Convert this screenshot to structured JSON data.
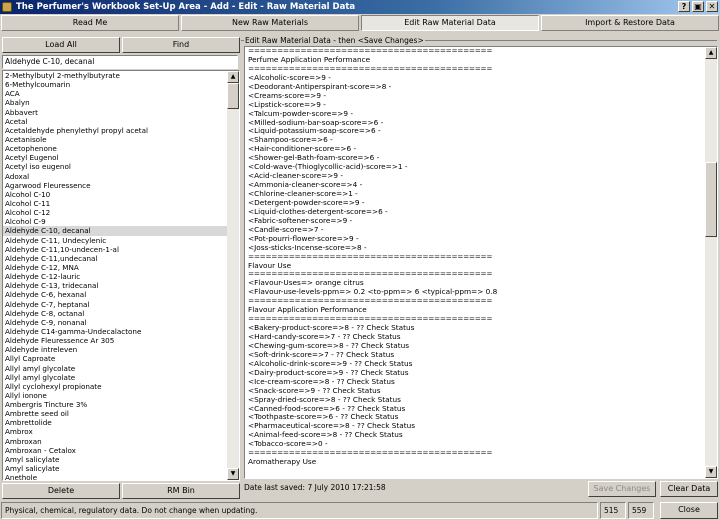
{
  "window": {
    "title": "The Perfumer's Workbook Set-Up Area  -  Add - Edit  -  Raw Material Data",
    "help_btn": "?",
    "max_btn": "▣",
    "close_btn": "✕"
  },
  "tabs": [
    "Read Me",
    "New Raw Materials",
    "Edit Raw Material Data",
    "Import & Restore Data"
  ],
  "left": {
    "load_all": "Load All",
    "find": "Find",
    "search_value": "Aldehyde C-10, decanal",
    "items": [
      "2-Methylbutyl 2-methylbutyrate",
      "6-Methylcoumarin",
      "ACA",
      "Abalyn",
      "Abbavert",
      "Acetal",
      "Acetaldehyde phenylethyl propyl acetal",
      "Acetanisole",
      "Acetophenone",
      "Acetyl Eugenol",
      "Acetyl iso eugenol",
      "Adoxal",
      "Agarwood Fleuressence",
      "Alcohol C-10",
      "Alcohol C-11",
      "Alcohol C-12",
      "Alcohol C-9",
      "Aldehyde C-10, decanal",
      "Aldehyde C-11, Undecylenic",
      "Aldehyde C-11,10-undecen-1-al",
      "Aldehyde C-11,undecanal",
      "Aldehyde C-12, MNA",
      "Aldehyde C-12-lauric",
      "Aldehyde C-13, tridecanal",
      "Aldehyde C-6, hexanal",
      "Aldehyde C-7, heptanal",
      "Aldehyde C-8, octanal",
      "Aldehyde C-9, nonanal",
      "Aldehyde C14-gamma-Undecalactone",
      "Aldehyde Fleuressence Ar 305",
      "Aldehyde intreleven",
      "Allyl Caproate",
      "Allyl amyl glycolate",
      "Allyl amyl glycolate",
      "Allyl cyclohexyl propionate",
      "Allyl ionone",
      "Ambergris Tincture 3%",
      "Ambrette seed oil",
      "Ambrettolide",
      "Ambrox",
      "Ambroxan",
      "Ambroxan - Cetalox",
      "Amyl salicylate",
      "Amyl salicylate",
      "Anethole"
    ],
    "delete": "Delete",
    "rm_bin": "RM Bin"
  },
  "right": {
    "group_label": "Edit Raw Material Data - then  <Save Changes>",
    "lines": [
      "==========================================",
      "Perfume Application Performance",
      "==========================================",
      "<Alcoholic-score=>9 -",
      "<Deodorant-Antiperspirant-score=>8 -",
      "<Creams-score=>9 -",
      "<Lipstick-score=>9 -",
      "<Talcum-powder-score=>9 -",
      "<Milled-sodium-bar-soap-score=>6 -",
      "<Liquid-potassium-soap-score=>6 -",
      "<Shampoo-score=>6 -",
      "<Hair-conditioner-score=>6 -",
      "<Shower-gel-Bath-foam-score=>6 -",
      "<Cold-wave-(Thioglycollic-acid)-score=>1 -",
      "<Acid-cleaner-score=>9 -",
      "<Ammonia-cleaner-score=>4 -",
      "<Chlorine-cleaner-score=>1 -",
      "<Detergent-powder-score=>9 -",
      "<Liquid-clothes-detergent-score=>6 -",
      "<Fabric-softener-score=>9 -",
      "<Candle-score=>7 -",
      "<Pot-pourri-flower-score=>9 -",
      "<Joss-sticks-Incense-score=>8 -",
      "==========================================",
      "Flavour Use",
      "==========================================",
      "<Flavour-Uses=> orange citrus",
      "<Flavour-use-levels-ppm=> 0.2 <to-ppm=> 6 <typical-ppm=> 0.8",
      "==========================================",
      "Flavour Application Performance",
      "==========================================",
      "<Bakery-product-score=>8 - ?? Check Status",
      "<Hard-candy-score=>7 - ?? Check Status",
      "<Chewing-gum-score=>8 - ?? Check Status",
      "<Soft-drink-score=>7 - ?? Check Status",
      "<Alcoholic-drink-score=>9 - ?? Check Status",
      "<Dairy-product-score=>9 - ?? Check Status",
      "<Ice-cream-score=>8 - ?? Check Status",
      "<Snack-score=>9 - ?? Check Status",
      "<Spray-dried-score=>8 - ?? Check Status",
      "<Canned-food-score=>6 - ?? Check Status",
      "<Toothpaste-score=>6 - ?? Check Status",
      "<Pharmaceutical-score=>8 - ?? Check Status",
      "<Animal-feed-score=>8 - ?? Check Status",
      "<Tobacco-score=>0 -",
      "==========================================",
      "Aromatherapy Use"
    ],
    "date_saved": "Date last saved: 7 July 2010  17:21:58",
    "save_changes": "Save Changes",
    "clear_data": "Clear Data"
  },
  "status": {
    "message": "Physical, chemical, regulatory data. Do not change when updating.",
    "num1": "515",
    "num2": "559",
    "close": "Close"
  }
}
